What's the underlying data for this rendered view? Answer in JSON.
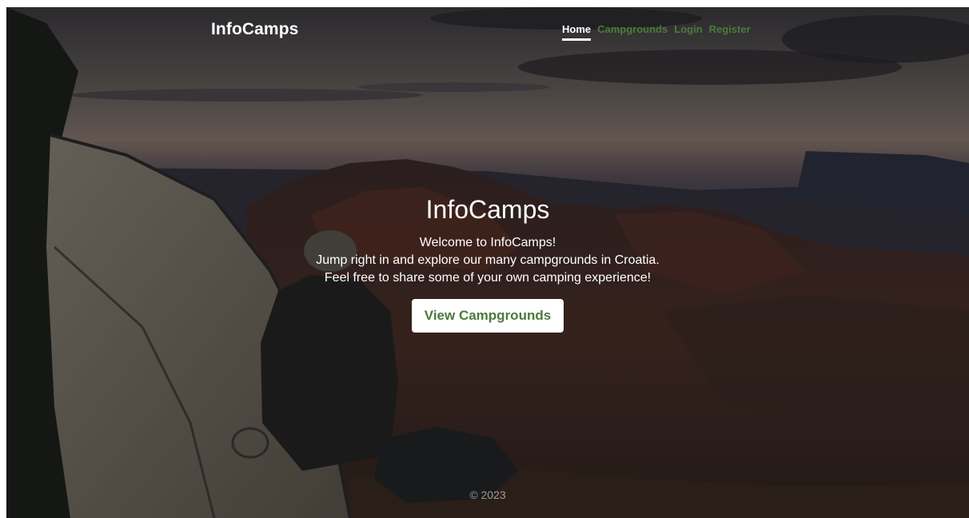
{
  "navbar": {
    "brand": "InfoCamps",
    "links": [
      {
        "label": "Home",
        "active": true
      },
      {
        "label": "Campgrounds",
        "active": false
      },
      {
        "label": "Login",
        "active": false
      },
      {
        "label": "Register",
        "active": false
      }
    ]
  },
  "hero": {
    "title": "InfoCamps",
    "lines": [
      "Welcome to InfoCamps!",
      "Jump right in and explore our many campgrounds in Croatia.",
      "Feel free to share some of your own camping experience!"
    ],
    "cta_label": "View Campgrounds"
  },
  "footer": {
    "text": "© 2023"
  },
  "colors": {
    "accent": "#4a7a3d",
    "nav_link": "#4d7a3c",
    "text": "#ffffff"
  }
}
